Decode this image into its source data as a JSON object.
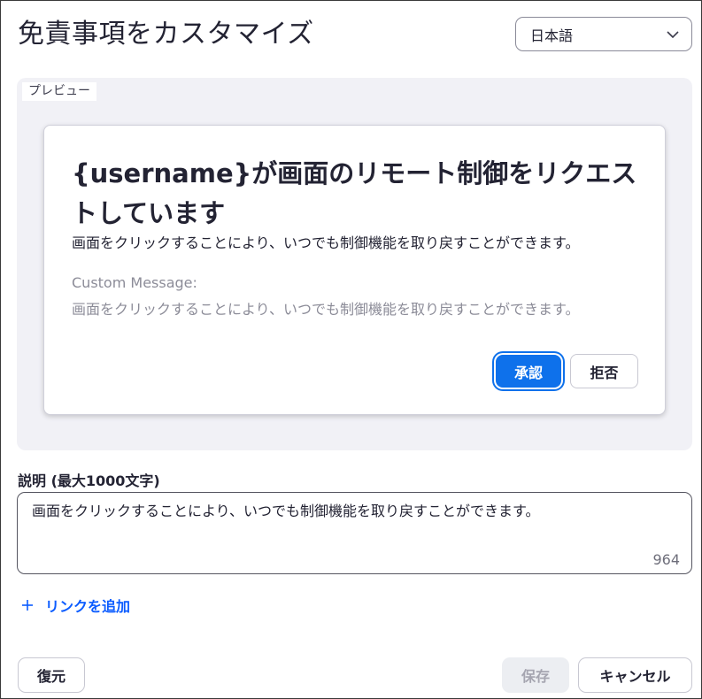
{
  "dialog": {
    "title": "免責事項をカスタマイズ",
    "language": {
      "selected": "日本語",
      "icon": "chevron-down-icon"
    }
  },
  "preview": {
    "tag": "プレビュー",
    "card": {
      "heading": "{username}が画面のリモート制御をリクエストしています",
      "body": "画面をクリックすることにより、いつでも制御機能を取り戻すことができます。",
      "custom_label": "Custom Message:",
      "custom_message": "画面をクリックすることにより、いつでも制御機能を取り戻すことができます。",
      "approve_label": "承認",
      "deny_label": "拒否"
    }
  },
  "description": {
    "label": "説明 (最大1000文字)",
    "value": "画面をクリックすることにより、いつでも制御機能を取り戻すことができます。",
    "remaining": "964"
  },
  "add_link": {
    "label": "リンクを追加",
    "icon": "plus-icon"
  },
  "footer": {
    "restore_label": "復元",
    "save_label": "保存",
    "cancel_label": "キャンセル"
  },
  "colors": {
    "primary": "#0e71eb",
    "link": "#0b5cff",
    "preview_bg": "#f1f1f6",
    "muted_text": "#8c8c98",
    "disabled_bg": "#eceef2"
  }
}
